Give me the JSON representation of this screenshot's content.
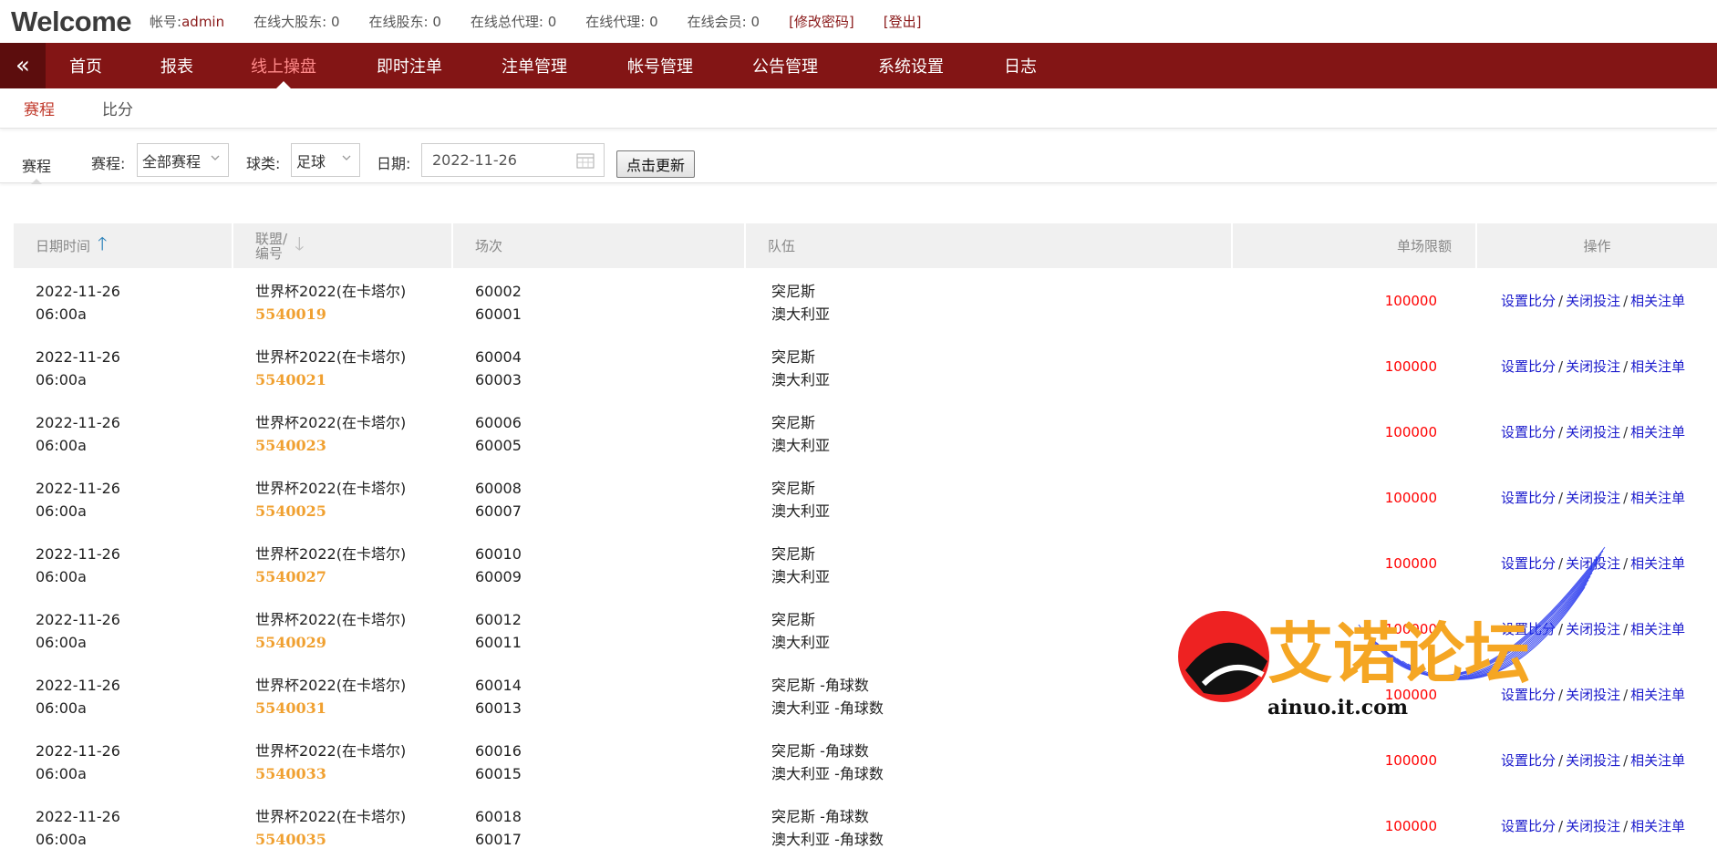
{
  "header": {
    "welcome": "Welcome",
    "account_label": "帐号:",
    "account_value": "admin",
    "stats": [
      {
        "label": "在线大股东:",
        "value": "0"
      },
      {
        "label": "在线股东:",
        "value": "0"
      },
      {
        "label": "在线总代理:",
        "value": "0"
      },
      {
        "label": "在线代理:",
        "value": "0"
      },
      {
        "label": "在线会员:",
        "value": "0"
      }
    ],
    "change_password": "[修改密码]",
    "logout": "[登出]"
  },
  "nav": {
    "collapse_icon": "double-chevron-left-icon",
    "items": [
      {
        "label": "首页"
      },
      {
        "label": "报表"
      },
      {
        "label": "线上操盘",
        "active": true
      },
      {
        "label": "即时注单"
      },
      {
        "label": "注单管理"
      },
      {
        "label": "帐号管理"
      },
      {
        "label": "公告管理"
      },
      {
        "label": "系统设置"
      },
      {
        "label": "日志"
      }
    ]
  },
  "subtabs": [
    {
      "label": "赛程",
      "active": true
    },
    {
      "label": "比分"
    }
  ],
  "filter": {
    "tab": "赛程",
    "schedule_label": "赛程:",
    "schedule_value": "全部赛程",
    "sport_label": "球类:",
    "sport_value": "足球",
    "date_label": "日期:",
    "date_value": "2022-11-26",
    "update_button": "点击更新"
  },
  "table": {
    "headers": {
      "date": "日期时间",
      "league_line1": "联盟/",
      "league_line2": "编号",
      "match": "场次",
      "team": "队伍",
      "limit": "单场限额",
      "ops": "操作"
    },
    "rows": [
      {
        "date": "2022-11-26",
        "time": "06:00a",
        "league": "世界杯2022(在卡塔尔)",
        "code": "5540019",
        "match_a": "60002",
        "match_b": "60001",
        "team_a": "突尼斯",
        "team_b": "澳大利亚",
        "limit": "100000"
      },
      {
        "date": "2022-11-26",
        "time": "06:00a",
        "league": "世界杯2022(在卡塔尔)",
        "code": "5540021",
        "match_a": "60004",
        "match_b": "60003",
        "team_a": "突尼斯",
        "team_b": "澳大利亚",
        "limit": "100000"
      },
      {
        "date": "2022-11-26",
        "time": "06:00a",
        "league": "世界杯2022(在卡塔尔)",
        "code": "5540023",
        "match_a": "60006",
        "match_b": "60005",
        "team_a": "突尼斯",
        "team_b": "澳大利亚",
        "limit": "100000"
      },
      {
        "date": "2022-11-26",
        "time": "06:00a",
        "league": "世界杯2022(在卡塔尔)",
        "code": "5540025",
        "match_a": "60008",
        "match_b": "60007",
        "team_a": "突尼斯",
        "team_b": "澳大利亚",
        "limit": "100000"
      },
      {
        "date": "2022-11-26",
        "time": "06:00a",
        "league": "世界杯2022(在卡塔尔)",
        "code": "5540027",
        "match_a": "60010",
        "match_b": "60009",
        "team_a": "突尼斯",
        "team_b": "澳大利亚",
        "limit": "100000"
      },
      {
        "date": "2022-11-26",
        "time": "06:00a",
        "league": "世界杯2022(在卡塔尔)",
        "code": "5540029",
        "match_a": "60012",
        "match_b": "60011",
        "team_a": "突尼斯",
        "team_b": "澳大利亚",
        "limit": "100000"
      },
      {
        "date": "2022-11-26",
        "time": "06:00a",
        "league": "世界杯2022(在卡塔尔)",
        "code": "5540031",
        "match_a": "60014",
        "match_b": "60013",
        "team_a": "突尼斯 -角球数",
        "team_b": "澳大利亚 -角球数",
        "limit": "100000"
      },
      {
        "date": "2022-11-26",
        "time": "06:00a",
        "league": "世界杯2022(在卡塔尔)",
        "code": "5540033",
        "match_a": "60016",
        "match_b": "60015",
        "team_a": "突尼斯 -角球数",
        "team_b": "澳大利亚 -角球数",
        "limit": "100000"
      },
      {
        "date": "2022-11-26",
        "time": "06:00a",
        "league": "世界杯2022(在卡塔尔)",
        "code": "5540035",
        "match_a": "60018",
        "match_b": "60017",
        "team_a": "突尼斯 -角球数",
        "team_b": "澳大利亚 -角球数",
        "limit": "100000"
      }
    ],
    "ops": {
      "set_score": "设置比分",
      "close_betting": "关闭投注",
      "related_bets": "相关注单",
      "separator": "/"
    }
  },
  "watermark": {
    "text": "艾诺论坛",
    "domain": "ainuo.it.com"
  },
  "colors": {
    "nav_bg": "#831515",
    "nav_active": "#ff8a8a",
    "league_code": "#f0a030",
    "limit": "#ff0000",
    "op_link": "#1a1acc"
  }
}
